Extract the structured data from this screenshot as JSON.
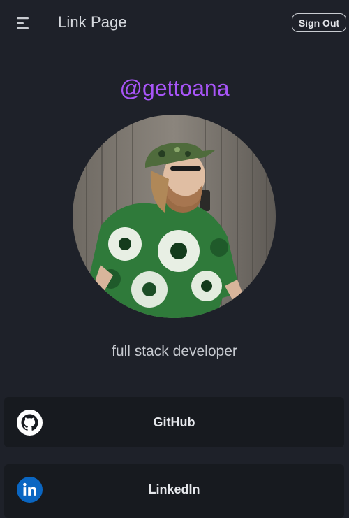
{
  "header": {
    "title": "Link Page",
    "sign_out_label": "Sign Out",
    "menu_icon": "menu-icon"
  },
  "profile": {
    "username": "@gettoana",
    "bio": "full stack developer",
    "avatar": "profile-photo"
  },
  "links": [
    {
      "label": "GitHub",
      "icon": "github-icon"
    },
    {
      "label": "LinkedIn",
      "icon": "linkedin-icon"
    }
  ],
  "colors": {
    "background": "#1e2129",
    "card": "#171a1f",
    "accent": "#a855f7",
    "linkedin_blue": "#0a66c2"
  }
}
